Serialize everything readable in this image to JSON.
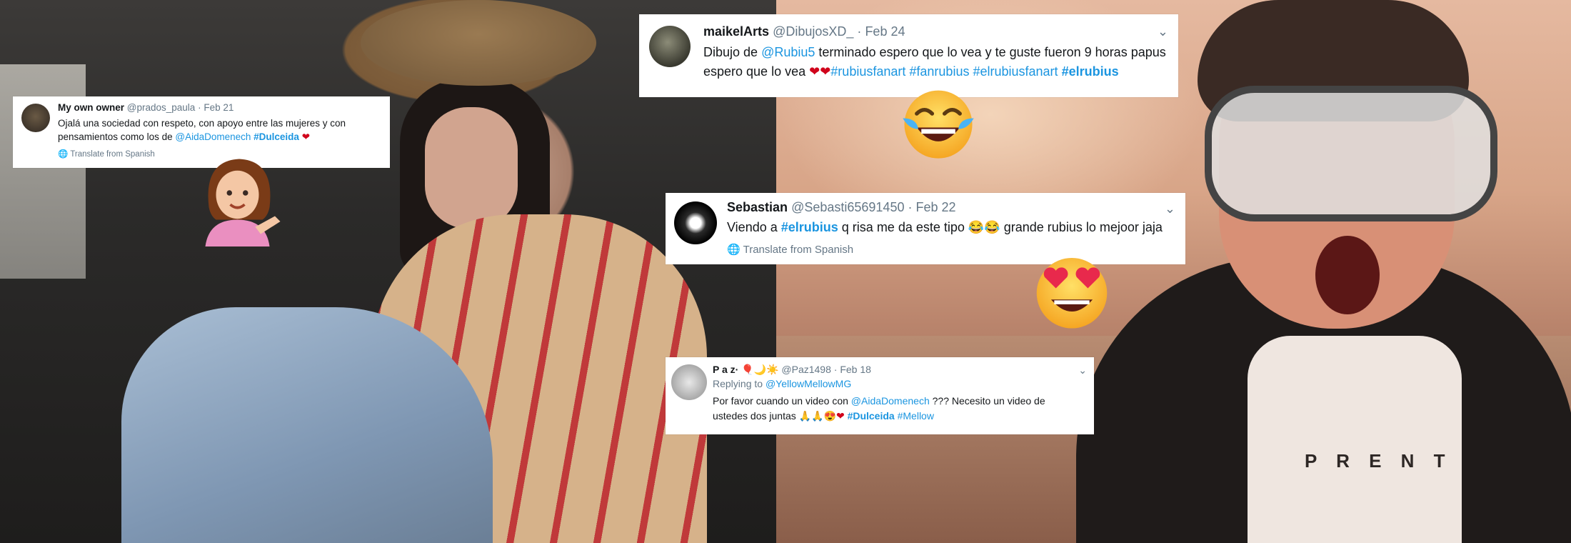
{
  "tweets": [
    {
      "name": "My own owner",
      "handle": "@prados_paula",
      "date": "Feb 21",
      "text_1": "Ojalá una sociedad con  respeto, con apoyo entre las mujeres y con",
      "text_2": "pensamientos como los de",
      "mention": "@AidaDomenech",
      "hashtag": "#Dulceida",
      "emoji": "heart",
      "translate": "Translate from Spanish"
    },
    {
      "name": "maikelArts",
      "handle": "@DibujosXD_",
      "date": "Feb 24",
      "text_1": "Dibujo de",
      "mention": "@Rubiu5",
      "text_2": "terminado espero que lo vea y te guste fueron 9 horas papus",
      "text_3": "espero que lo vea",
      "emoji": "two hearts",
      "hashtags": [
        "#rubiusfanart",
        "#fanrubius",
        "#elrubiusfanart",
        "#elrubius"
      ]
    },
    {
      "name": "Sebastian",
      "handle": "@Sebasti65691450",
      "date": "Feb 22",
      "text_1": "Viendo a",
      "hashtag": "#elrubius",
      "text_2": "q risa me da este tipo",
      "emoji": "tears of joy x2",
      "text_3": "grande rubius lo mejoor jaja",
      "translate": "Translate from Spanish"
    },
    {
      "name": "P a z·",
      "handle": "@Paz1498",
      "date": "Feb 18",
      "replying_label": "Replying to",
      "replying_to": "@YellowMellowMG",
      "text_1": "Por favor cuando un video con",
      "mention": "@AidaDomenech",
      "text_2": "??? Necesito un video de",
      "text_3": "ustedes dos juntas",
      "hashtags": [
        "#Dulceida",
        "#Mellow"
      ]
    }
  ],
  "shirt_text": "P R E N T",
  "stickers": [
    "face-with-tears-of-joy",
    "smiling-face-with-heart-eyes",
    "information-desk-person"
  ],
  "colors": {
    "link": "#1b95e0",
    "muted": "#657786",
    "heart": "#d0021b"
  }
}
